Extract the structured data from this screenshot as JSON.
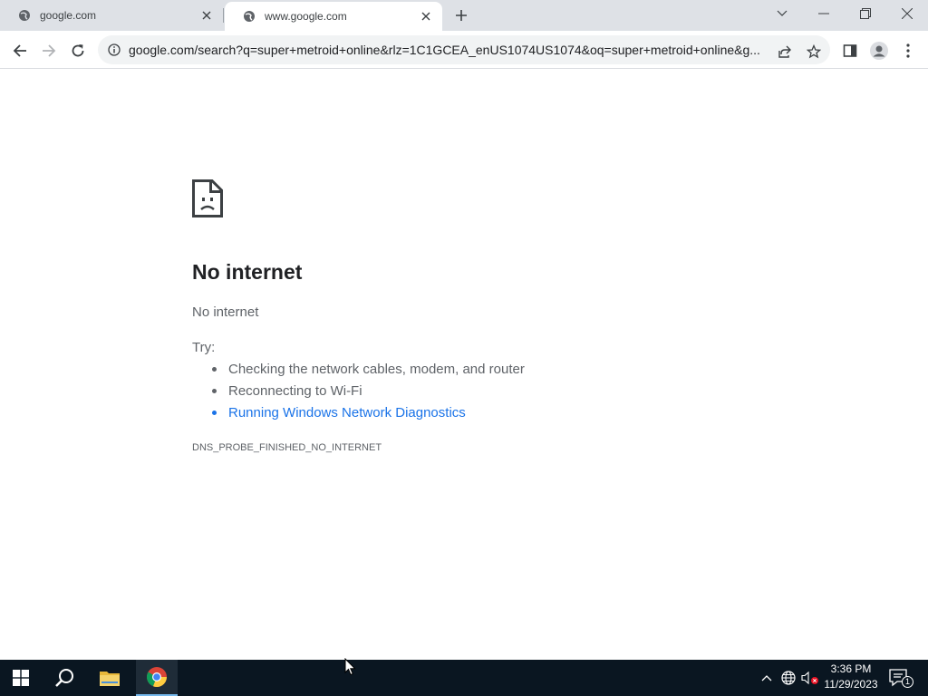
{
  "tabs": [
    {
      "title": "google.com",
      "favicon": "globe-icon",
      "active": false
    },
    {
      "title": "www.google.com",
      "favicon": "globe-icon",
      "active": true
    }
  ],
  "toolbar": {
    "url": "google.com/search?q=super+metroid+online&rlz=1C1GCEA_enUS1074US1074&oq=super+metroid+online&g..."
  },
  "error": {
    "title": "No internet",
    "subtitle": "No internet",
    "try_label": "Try:",
    "suggestions": [
      "Checking the network cables, modem, and router",
      "Reconnecting to Wi-Fi",
      "Running Windows Network Diagnostics"
    ],
    "code": "DNS_PROBE_FINISHED_NO_INTERNET"
  },
  "taskbar": {
    "time": "3:36 PM",
    "date": "11/29/2023",
    "notification_count": "1"
  },
  "colors": {
    "link": "#1a73e8",
    "taskbar": "#0a1621",
    "tabstrip": "#dee1e6"
  }
}
